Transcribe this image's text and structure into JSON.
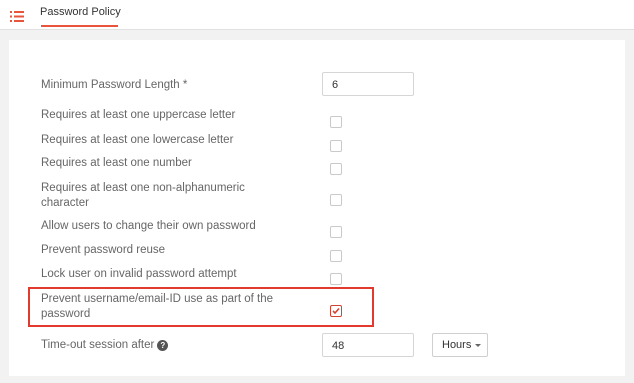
{
  "header": {
    "tab_label": "Password Policy",
    "menu_icon": "list-menu-icon",
    "accent_color": "#e8543e"
  },
  "policy": {
    "min_length_label": "Minimum Password Length *",
    "min_length_value": "6",
    "uppercase_label": "Requires at least one uppercase letter",
    "lowercase_label": "Requires at least one lowercase letter",
    "number_label": "Requires at least one number",
    "nonalnum_label": "Requires at least one non-alphanumeric character",
    "change_own_label": "Allow users to change their own password",
    "reuse_label": "Prevent password reuse",
    "lock_label": "Lock user on invalid password attempt",
    "prevent_username_label": "Prevent username/email-ID use as part of the password",
    "timeout_label": "Time-out session after",
    "timeout_value": "48",
    "timeout_unit": "Hours",
    "help_icon_glyph": "?"
  },
  "checkboxes": {
    "uppercase": false,
    "lowercase": false,
    "number": false,
    "nonalnum": false,
    "change_own": false,
    "reuse": false,
    "lock": false,
    "prevent_username": true
  },
  "highlight_color": "#e23b2e"
}
